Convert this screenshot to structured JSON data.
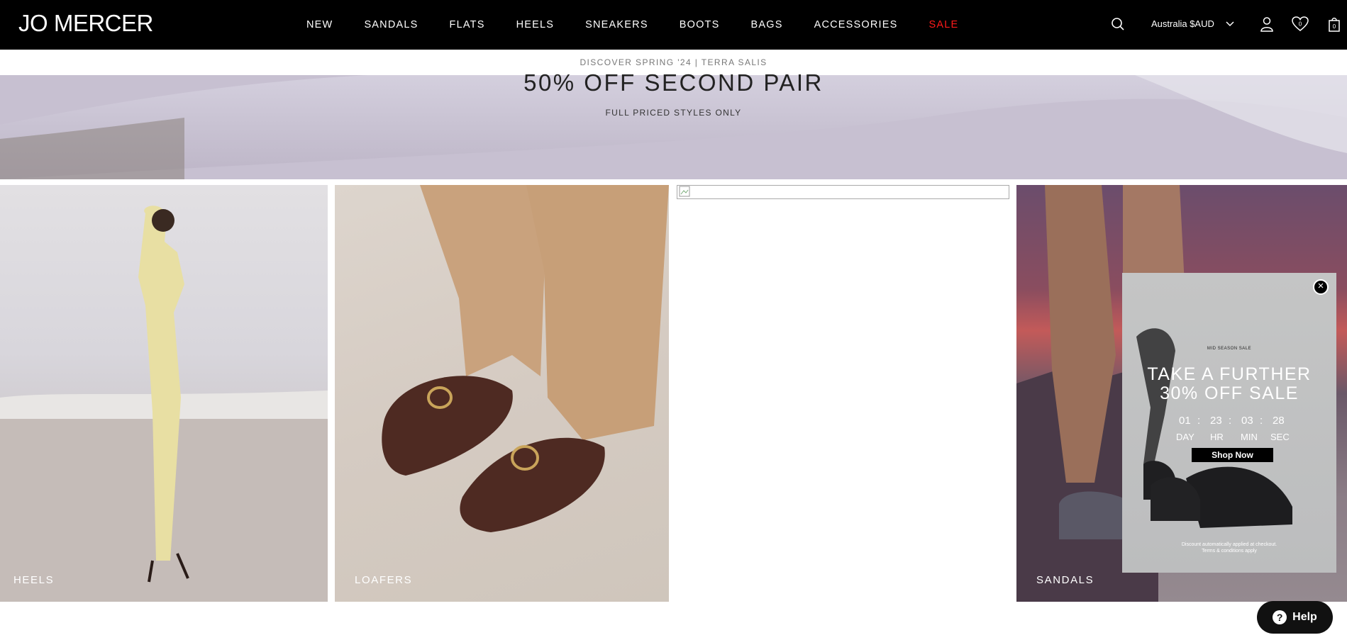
{
  "header": {
    "logo": "JO MERCER",
    "nav": [
      "NEW",
      "SANDALS",
      "FLATS",
      "HEELS",
      "SNEAKERS",
      "BOOTS",
      "BAGS",
      "ACCESSORIES",
      "SALE"
    ],
    "country": "Australia $AUD",
    "wishlist_count": "0",
    "cart_count": "0",
    "icons": [
      "search-icon",
      "chevron-down-icon",
      "account-icon",
      "wishlist-icon",
      "cart-icon"
    ],
    "sale_color": "#ff1a1a"
  },
  "strip": {
    "text": "DISCOVER SPRING '24 | TERRA SALIS"
  },
  "hero": {
    "title": "50% OFF SECOND PAIR",
    "subtitle": "FULL PRICED STYLES ONLY"
  },
  "tiles": [
    {
      "label": "HEELS"
    },
    {
      "label": "LOAFERS"
    },
    {
      "label": ""
    },
    {
      "label": "SANDALS"
    }
  ],
  "popup": {
    "eyebrow": "MID SEASON SALE",
    "title_line1": "TAKE A FURTHER",
    "title_line2": "30% OFF SALE",
    "timer": {
      "day": "01",
      "hr": "23",
      "min": "03",
      "sec": "28",
      "sep": ":"
    },
    "units": {
      "day": "DAY",
      "hr": "HR",
      "min": "MIN",
      "sec": "SEC"
    },
    "button": "Shop Now",
    "footer_line1": "Discount automatically applied at checkout.",
    "footer_line2": "Terms & conditions apply"
  },
  "help": {
    "label": "Help"
  }
}
